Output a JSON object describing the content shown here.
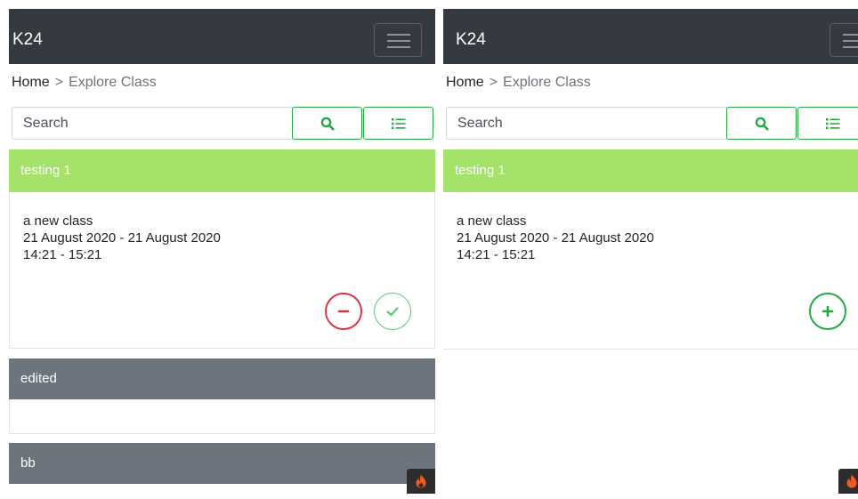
{
  "panels": [
    {
      "navbar": {
        "brand": "K24"
      },
      "breadcrumb": {
        "home": "Home",
        "separator": ">",
        "current": "Explore Class"
      },
      "search": {
        "placeholder": "Search"
      },
      "cards": [
        {
          "header": "testing 1",
          "body": [
            "a new class",
            "21 August 2020 - 21 August 2020",
            "14:21 - 15:21"
          ],
          "actions": [
            "minus-circle",
            "check-circle"
          ]
        },
        {
          "header": "edited"
        },
        {
          "header": "bb"
        }
      ]
    },
    {
      "navbar": {
        "brand": "K24"
      },
      "breadcrumb": {
        "home": "Home",
        "separator": ">",
        "current": "Explore Class"
      },
      "search": {
        "placeholder": "Search"
      },
      "cards": [
        {
          "header": "testing 1",
          "body": [
            "a new class",
            "21 August 2020 - 21 August 2020",
            "14:21 - 15:21"
          ],
          "actions": [
            "plus-circle"
          ]
        }
      ]
    }
  ],
  "colors": {
    "navbar": "#343a40",
    "header_active": "#a4e26a",
    "header_inactive": "#6c757d",
    "success": "#28a745",
    "danger": "#dc3545"
  },
  "icons": [
    "hamburger-icon",
    "search-icon",
    "list-icon",
    "minus-icon",
    "check-icon",
    "plus-icon",
    "fire-icon"
  ]
}
